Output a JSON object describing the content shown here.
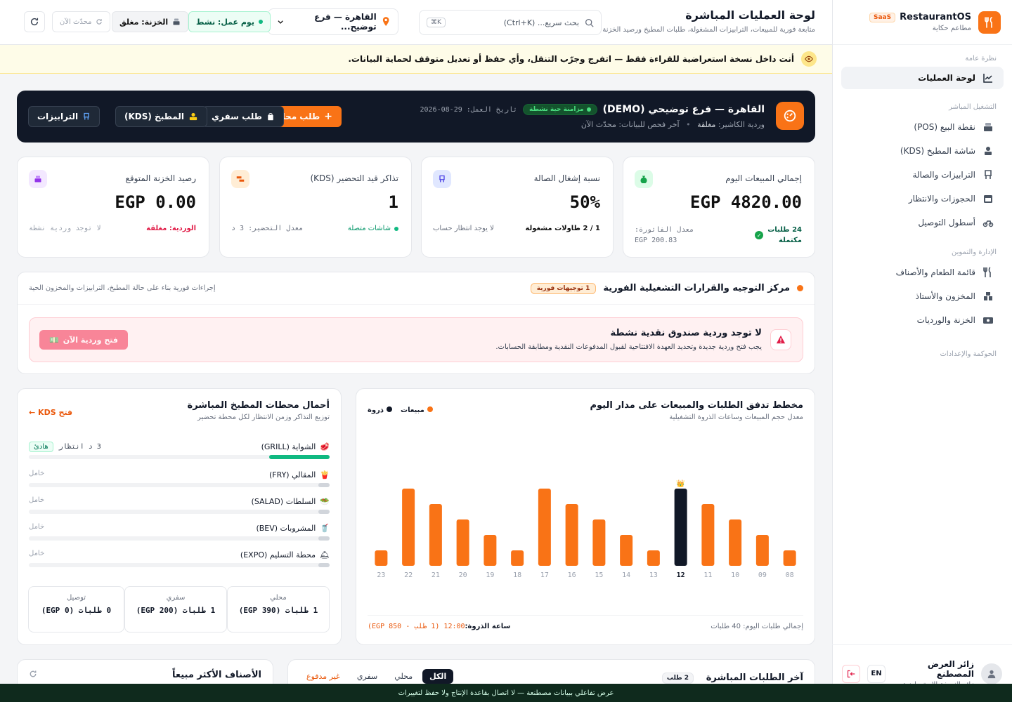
{
  "sidebar": {
    "brand": "RestaurantOS",
    "badge": "SaaS",
    "subtitle": "مطاعم حكاية",
    "sections": [
      {
        "title": "نظرة عامة",
        "items": [
          {
            "label": "لوحة العمليات",
            "icon": "chart-icon",
            "active": true
          }
        ]
      },
      {
        "title": "التشغيل المباشر",
        "items": [
          {
            "label": "نقطة البيع (POS)",
            "icon": "register-icon"
          },
          {
            "label": "شاشة المطبخ (KDS)",
            "icon": "chef-icon"
          },
          {
            "label": "الترابيزات والصالة",
            "icon": "chair-icon"
          },
          {
            "label": "الحجوزات والانتظار",
            "icon": "calendar-icon"
          },
          {
            "label": "أسطول التوصيل",
            "icon": "motorbike-icon"
          }
        ]
      },
      {
        "title": "الإدارة والتموين",
        "items": [
          {
            "label": "قائمة الطعام والأصناف",
            "icon": "utensils-icon"
          },
          {
            "label": "المخزون والأستاذ",
            "icon": "boxes-icon"
          },
          {
            "label": "الخزنة والورديات",
            "icon": "cash-icon"
          }
        ]
      },
      {
        "title": "الحوكمة والإعدادات",
        "items": []
      }
    ],
    "user": {
      "name": "زائر العرض المصطنع",
      "role": "زائر النسخة الاستعراضية",
      "lang": "EN"
    }
  },
  "header": {
    "title": "لوحة العمليات المباشرة",
    "subtitle": "متابعة فورية للمبيعات، الترابيزات المشغولة، طلبات المطبخ ورصيد الخزنة",
    "search_placeholder": "بحث سريع... (Ctrl+K)",
    "search_kbd": "K⌘",
    "branch": "القاهرة — فرع توضيح...",
    "workday": "يوم عمل: نشط",
    "treasury": "الخزنة: مغلق",
    "updated": "محدّث الآن"
  },
  "banner": "أنت داخل نسخة استعراضية للقراءة فقط — اتفرج وجرّب التنقل، وأي حفظ أو تعديل متوقف لحماية البيانات.",
  "hero": {
    "title": "القاهرة — فرع توضيحي (DEMO)",
    "sync": "مزامنة حية نشطة",
    "date_label": "تاريخ العمل:",
    "date": "29-08-2026",
    "shift_label": "وردية الكاشير:",
    "shift": "مغلقة",
    "check": "آخر فحص للبيانات: محدّث الآن",
    "buttons": {
      "local": "طلب محلي",
      "takeaway": "طلب سفري",
      "kitchen": "المطبخ (KDS)",
      "tables": "الترابيزات"
    }
  },
  "kpis": [
    {
      "label": "إجمالي المبيعات اليوم",
      "value": "EGP 4820.00",
      "foot_a": "24 طلبات",
      "foot_a2": "مكتملة",
      "foot_b": "معدل الفاتورة: 200.83 EGP",
      "icon": "money-bag-icon",
      "color": "#16a34a",
      "bg": "#dcfce7"
    },
    {
      "label": "نسبة إشغال الصالة",
      "value": "50%",
      "foot_a": "1 / 2 طاولات مشغولة",
      "foot_b": "لا يوجد انتظار حساب",
      "icon": "chair-icon",
      "color": "#4f46e5",
      "bg": "#e0e7ff"
    },
    {
      "label": "تذاكر قيد التحضير (KDS)",
      "value": "1",
      "foot_a": "شاشات متصلة",
      "foot_b": "معدل التحضير: 3 د",
      "icon": "tickets-icon",
      "color": "#ea580c",
      "bg": "#ffedd5"
    },
    {
      "label": "رصيد الخزنة المتوقع",
      "value": "EGP 0.00",
      "foot_a": "الوردية: مغلقة",
      "foot_b": "لا توجد وردية نشطة",
      "icon": "register-icon",
      "color": "#9333ea",
      "bg": "#f3e8ff"
    }
  ],
  "command": {
    "title": "مركز التوجيه والقرارات التشغيلية الفورية",
    "badge": "1 توجيهات فورية",
    "note": "إجراءات فورية بناء على حالة المطبخ، الترابيزات والمخزون الحية",
    "alert_title": "لا توجد وردية صندوق نقدية نشطة",
    "alert_desc": "يجب فتح وردية جديدة وتحديد العهدة الافتتاحية لقبول المدفوعات النقدية ومطابقة الحسابات.",
    "alert_button": "فتح وردية الآن"
  },
  "chart_card": {
    "title": "مخطط تدفق الطلبات والمبيعات على مدار اليوم",
    "subtitle": "معدل حجم المبيعات وساعات الذروة التشغيلية",
    "legend_sales": "مبيعات",
    "legend_peak": "ذروة",
    "peak_label": "ساعة الذروة:",
    "peak_value": "12:00 (1 طلب - 850 EGP)",
    "total": "إجمالي طلبات اليوم: 40 طلبات",
    "colors": {
      "sales": "#f97316",
      "peak": "#111827"
    }
  },
  "chart_data": {
    "type": "bar",
    "categories": [
      "08",
      "09",
      "10",
      "11",
      "12",
      "13",
      "14",
      "15",
      "16",
      "17",
      "18",
      "19",
      "20",
      "21",
      "22",
      "23"
    ],
    "values": [
      20,
      40,
      60,
      80,
      100,
      20,
      40,
      60,
      80,
      100,
      20,
      40,
      60,
      80,
      100,
      20
    ],
    "peak_category": "12",
    "peak_marker": "👑",
    "series": [
      {
        "name": "مبيعات"
      },
      {
        "name": "ذروة"
      }
    ]
  },
  "kds": {
    "title": "أحمال محطات المطبخ المباشرة",
    "subtitle": "توزيع التذاكر وزمن الانتظار لكل محطة تحضير",
    "link": "فتح KDS ←",
    "stations": [
      {
        "name": "الشواية (GRILL)",
        "emoji": "🥩",
        "status": "3 د انتظار",
        "badge": "هادئ",
        "load": 1.0
      },
      {
        "name": "المقالي (FRY)",
        "emoji": "🍟",
        "status": "خامل",
        "badge": "",
        "load": 0
      },
      {
        "name": "السلطات (SALAD)",
        "emoji": "🥗",
        "status": "خامل",
        "badge": "",
        "load": 0
      },
      {
        "name": "المشروبات (BEV)",
        "emoji": "🥤",
        "status": "خامل",
        "badge": "",
        "load": 0
      },
      {
        "name": "محطة التسليم (EXPO)",
        "emoji": "🛎",
        "status": "خامل",
        "badge": "",
        "load": 0
      }
    ],
    "channels": [
      {
        "label": "محلي",
        "value": "1 طلبات (390 EGP)"
      },
      {
        "label": "سفري",
        "value": "1 طلبات (200 EGP)"
      },
      {
        "label": "توصيل",
        "value": "0 طلبات (0 EGP)"
      }
    ]
  },
  "orders": {
    "title": "آخر الطلبات المباشرة",
    "count": "2 طلب",
    "tabs": [
      "الكل",
      "محلي",
      "سفري",
      "غير مدفوع"
    ]
  },
  "bestsellers": {
    "title": "الأصناف الأكثر مبيعاً"
  },
  "footer": "عرض تفاعلي ببيانات مصطنعة — لا اتصال بقاعدة الإنتاج ولا حفظ لتغييرات"
}
